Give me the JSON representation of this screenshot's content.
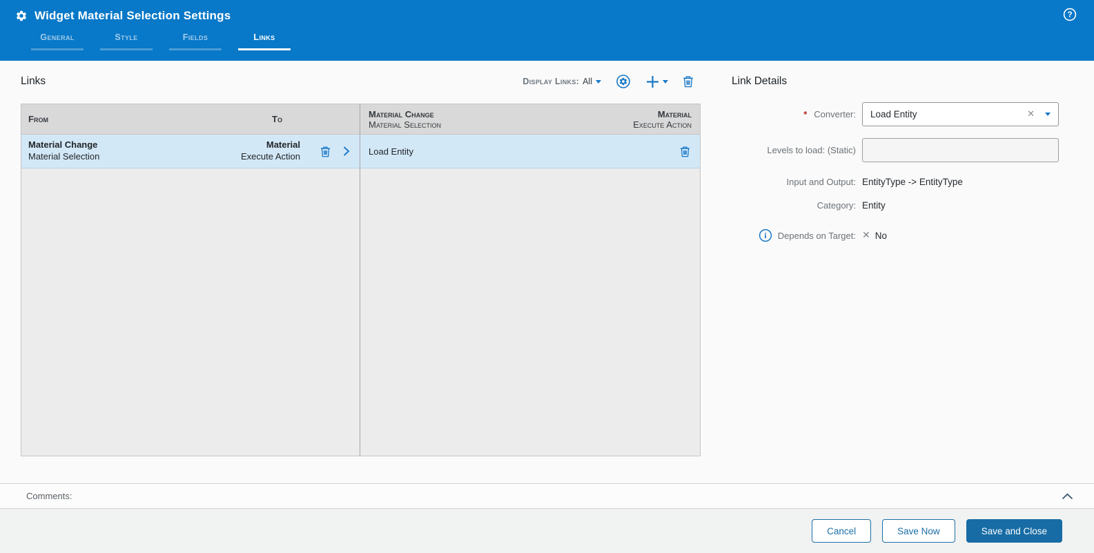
{
  "window": {
    "title": "Widget Material Selection Settings"
  },
  "tabs": [
    {
      "label": "General",
      "active": false
    },
    {
      "label": "Style",
      "active": false
    },
    {
      "label": "Fields",
      "active": false
    },
    {
      "label": "Links",
      "active": true
    }
  ],
  "links": {
    "title": "Links",
    "toolbar": {
      "display_links_label": "Display Links:",
      "display_links_value": "All"
    },
    "from_to_table": {
      "col_from": "From",
      "col_to": "To",
      "row": {
        "from_name": "Material Change",
        "from_detail": "Material Selection",
        "to_name": "Material",
        "to_detail": "Execute Action"
      }
    },
    "links_table": {
      "header_from_name": "Material Change",
      "header_from_detail": "Material Selection",
      "header_to_name": "Material",
      "header_to_detail": "Execute Action",
      "row": {
        "label": "Load Entity"
      }
    }
  },
  "link_details": {
    "title": "Link Details",
    "required_marker": "*",
    "converter_label": "Converter:",
    "converter_value": "Load Entity",
    "levels_label": "Levels to load: (Static)",
    "levels_value": "",
    "io_label": "Input and Output:",
    "io_value": "EntityType -> EntityType",
    "category_label": "Category:",
    "category_value": "Entity",
    "depends_label": "Depends on Target:",
    "depends_value": "No"
  },
  "comments": {
    "label": "Comments:"
  },
  "footer": {
    "cancel_label": "Cancel",
    "save_now_label": "Save Now",
    "save_and_close_label": "Save and Close"
  },
  "colors": {
    "header_blue": "#0878c8",
    "accent_blue": "#1778c8",
    "button_blue": "#176ca5",
    "selected_row_blue": "#d3e8f7",
    "required_red": "#b3261e"
  }
}
